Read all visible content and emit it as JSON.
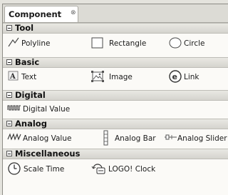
{
  "tab": {
    "label": "Component",
    "close_glyph": "⊗"
  },
  "sections": {
    "tool": {
      "title": "Tool",
      "items": [
        "Polyline",
        "Rectangle",
        "Circle"
      ]
    },
    "basic": {
      "title": "Basic",
      "items": [
        "Text",
        "Image",
        "Link"
      ]
    },
    "digital": {
      "title": "Digital",
      "items": [
        "Digital Value"
      ]
    },
    "analog": {
      "title": "Analog",
      "items": [
        "Analog Value",
        "Analog Bar",
        "Analog Slider"
      ]
    },
    "misc": {
      "title": "Miscellaneous",
      "items": [
        "Scale Time",
        "LOGO! Clock"
      ]
    }
  },
  "icons": {
    "polyline": "polyline-icon",
    "rectangle": "rectangle-icon",
    "circle": "circle-icon",
    "text": "text-icon",
    "image": "image-icon",
    "link": "link-icon",
    "digital": "digital-value-icon",
    "analog_value": "analog-value-icon",
    "analog_bar": "analog-bar-icon",
    "analog_slider": "analog-slider-icon",
    "scale_time": "clock-icon",
    "logo_clock": "logo-clock-icon"
  }
}
